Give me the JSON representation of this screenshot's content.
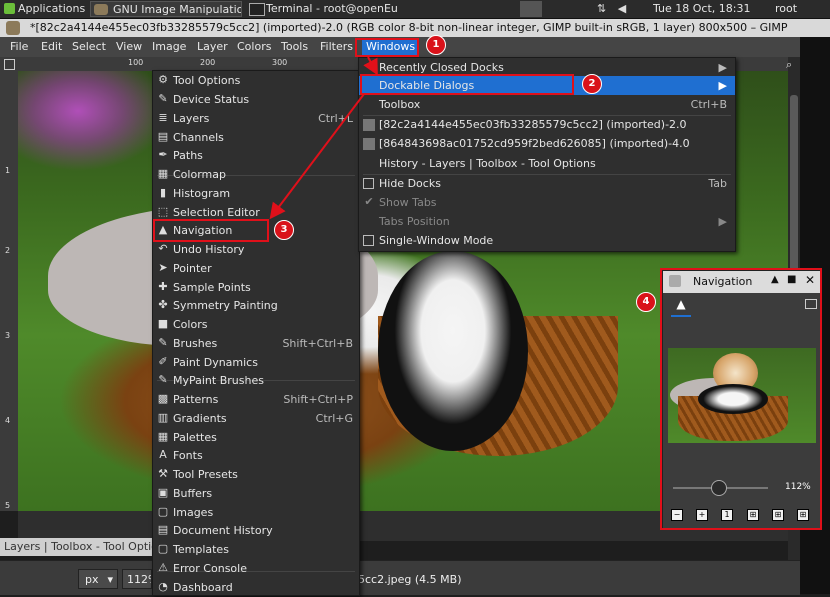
{
  "taskbar": {
    "applications": "Applications",
    "task_gimp": "GNU Image Manipulatio...",
    "task_terminal": "Terminal - root@openEu...",
    "clock": "Tue 18 Oct, 18:31",
    "user": "root"
  },
  "window": {
    "title": "*[82c2a4144e455ec03fb33285579c5cc2] (imported)-2.0 (RGB color 8-bit non-linear integer, GIMP built-in sRGB, 1 layer) 800x500 – GIMP"
  },
  "menubar": [
    "File",
    "Edit",
    "Select",
    "View",
    "Image",
    "Layer",
    "Colors",
    "Tools",
    "Filters",
    "Windows"
  ],
  "ruler": {
    "ticks": [
      "100",
      "200",
      "300"
    ],
    "vticks": [
      "1",
      "2",
      "3",
      "4",
      "5"
    ]
  },
  "windows_menu": {
    "items": [
      {
        "label": "Recently Closed Docks",
        "submenu": true
      },
      {
        "label": "Dockable Dialogs",
        "submenu": true,
        "highlighted": true
      },
      {
        "label": "Toolbox",
        "shortcut": "Ctrl+B"
      },
      {
        "label": "[82c2a4144e455ec03fb33285579c5cc2] (imported)-2.0"
      },
      {
        "label": "[864843698ac01752cd959f2bed626085] (imported)-4.0"
      },
      {
        "label": "History - Layers | Toolbox - Tool Options"
      },
      {
        "label": "Hide Docks",
        "shortcut": "Tab"
      },
      {
        "label": "Show Tabs"
      },
      {
        "label": "Tabs Position",
        "submenu": true
      },
      {
        "label": "Single-Window Mode"
      }
    ]
  },
  "dockable_menu": {
    "items": [
      {
        "label": "Tool Options",
        "icon": "tool-options-icon",
        "glyph": "⚙"
      },
      {
        "label": "Device Status",
        "icon": "device-status-icon",
        "glyph": "✎"
      },
      {
        "label": "Layers",
        "shortcut": "Ctrl+L",
        "icon": "layers-icon",
        "glyph": "≣"
      },
      {
        "label": "Channels",
        "icon": "channels-icon",
        "glyph": "▤"
      },
      {
        "label": "Paths",
        "icon": "paths-icon",
        "glyph": "✒"
      },
      {
        "label": "Colormap",
        "icon": "colormap-icon",
        "glyph": "▦"
      },
      {
        "label": "Histogram",
        "icon": "histogram-icon",
        "glyph": "▮"
      },
      {
        "label": "Selection Editor",
        "icon": "selection-editor-icon",
        "glyph": "⬚"
      },
      {
        "label": "Navigation",
        "icon": "navigation-icon",
        "glyph": "▲"
      },
      {
        "label": "Undo History",
        "icon": "undo-history-icon",
        "glyph": "↶"
      },
      {
        "label": "Pointer",
        "icon": "pointer-icon",
        "glyph": "➤"
      },
      {
        "label": "Sample Points",
        "icon": "sample-points-icon",
        "glyph": "✚"
      },
      {
        "label": "Symmetry Painting",
        "icon": "symmetry-painting-icon",
        "glyph": "✤"
      },
      {
        "label": "Colors",
        "icon": "colors-icon",
        "glyph": "■"
      },
      {
        "label": "Brushes",
        "shortcut": "Shift+Ctrl+B",
        "icon": "brushes-icon",
        "glyph": "✎"
      },
      {
        "label": "Paint Dynamics",
        "icon": "paint-dynamics-icon",
        "glyph": "✐"
      },
      {
        "label": "MyPaint Brushes",
        "icon": "mypaint-brushes-icon",
        "glyph": "✎"
      },
      {
        "label": "Patterns",
        "shortcut": "Shift+Ctrl+P",
        "icon": "patterns-icon",
        "glyph": "▩"
      },
      {
        "label": "Gradients",
        "shortcut": "Ctrl+G",
        "icon": "gradients-icon",
        "glyph": "▥"
      },
      {
        "label": "Palettes",
        "icon": "palettes-icon",
        "glyph": "▦"
      },
      {
        "label": "Fonts",
        "icon": "fonts-icon",
        "glyph": "A"
      },
      {
        "label": "Tool Presets",
        "icon": "tool-presets-icon",
        "glyph": "⚒"
      },
      {
        "label": "Buffers",
        "icon": "buffers-icon",
        "glyph": "▣"
      },
      {
        "label": "Images",
        "icon": "images-icon",
        "glyph": "▢"
      },
      {
        "label": "Document History",
        "icon": "document-history-icon",
        "glyph": "▤"
      },
      {
        "label": "Templates",
        "icon": "templates-icon",
        "glyph": "▢"
      },
      {
        "label": "Error Console",
        "icon": "error-console-icon",
        "glyph": "⚠"
      },
      {
        "label": "Dashboard",
        "icon": "dashboard-icon",
        "glyph": "◔"
      }
    ]
  },
  "annotations": [
    "1",
    "2",
    "3",
    "4"
  ],
  "navigation_dialog": {
    "title": "Navigation",
    "zoom": "112%",
    "buttons": [
      "zoom-out",
      "zoom-in",
      "zoom-1-1",
      "fit-image",
      "fill-window",
      "shrink-wrap"
    ]
  },
  "status": {
    "dock_tab": "Layers | Toolbox - Tool Options",
    "unit": "px",
    "zoom": "112%",
    "file": "5cc2.jpeg (4.5 MB)"
  },
  "colors": {
    "highlight": "#1f6fd1",
    "annotation": "#e0101a"
  }
}
